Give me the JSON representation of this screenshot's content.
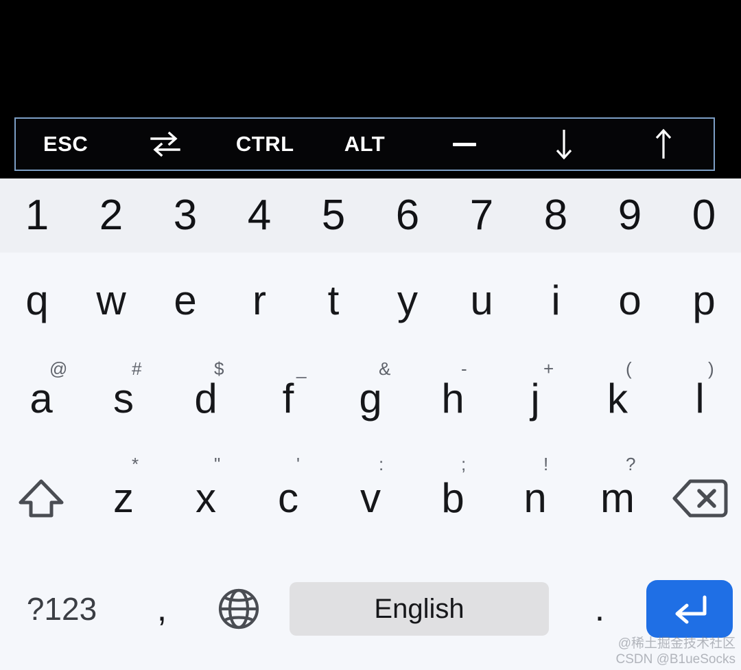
{
  "colors": {
    "toolbar_bg": "#050507",
    "toolbar_border": "#7d9fc6",
    "toolbar_text": "#ffffff",
    "number_row_bg": "#eef0f4",
    "keyboard_bg": "#f5f7fb",
    "key_text": "#16171a",
    "hint_text": "#5f636b",
    "spacebar_bg": "#e0e0e2",
    "enter_key_bg": "#1f6fe5",
    "screen_bg": "#000000"
  },
  "toolbar": {
    "keys": [
      {
        "label": "ESC",
        "name": "esc-key",
        "type": "text"
      },
      {
        "label": "",
        "name": "tab-key",
        "type": "icon",
        "icon": "tab-swap-icon"
      },
      {
        "label": "CTRL",
        "name": "ctrl-key",
        "type": "text"
      },
      {
        "label": "ALT",
        "name": "alt-key",
        "type": "text"
      },
      {
        "label": "–",
        "name": "minus-key",
        "type": "dash",
        "icon": "dash-icon"
      },
      {
        "label": "↓",
        "name": "arrow-down-key",
        "type": "icon",
        "icon": "arrow-down-icon"
      },
      {
        "label": "↑",
        "name": "arrow-up-key",
        "type": "icon",
        "icon": "arrow-up-icon"
      }
    ]
  },
  "keyboard": {
    "language": "English",
    "rows": {
      "numbers": [
        {
          "main": "1",
          "hint": ""
        },
        {
          "main": "2",
          "hint": ""
        },
        {
          "main": "3",
          "hint": ""
        },
        {
          "main": "4",
          "hint": ""
        },
        {
          "main": "5",
          "hint": ""
        },
        {
          "main": "6",
          "hint": ""
        },
        {
          "main": "7",
          "hint": ""
        },
        {
          "main": "8",
          "hint": ""
        },
        {
          "main": "9",
          "hint": ""
        },
        {
          "main": "0",
          "hint": ""
        }
      ],
      "top": [
        {
          "main": "q",
          "hint": ""
        },
        {
          "main": "w",
          "hint": ""
        },
        {
          "main": "e",
          "hint": ""
        },
        {
          "main": "r",
          "hint": ""
        },
        {
          "main": "t",
          "hint": ""
        },
        {
          "main": "y",
          "hint": ""
        },
        {
          "main": "u",
          "hint": ""
        },
        {
          "main": "i",
          "hint": ""
        },
        {
          "main": "o",
          "hint": ""
        },
        {
          "main": "p",
          "hint": ""
        }
      ],
      "home": [
        {
          "main": "a",
          "hint": "@"
        },
        {
          "main": "s",
          "hint": "#"
        },
        {
          "main": "d",
          "hint": "$"
        },
        {
          "main": "f",
          "hint": "_"
        },
        {
          "main": "g",
          "hint": "&"
        },
        {
          "main": "h",
          "hint": "-"
        },
        {
          "main": "j",
          "hint": "+"
        },
        {
          "main": "k",
          "hint": "("
        },
        {
          "main": "l",
          "hint": ")"
        }
      ],
      "bottom_letters": [
        {
          "main": "z",
          "hint": "*"
        },
        {
          "main": "x",
          "hint": "\""
        },
        {
          "main": "c",
          "hint": "'"
        },
        {
          "main": "v",
          "hint": ":"
        },
        {
          "main": "b",
          "hint": ";"
        },
        {
          "main": "n",
          "hint": "!"
        },
        {
          "main": "m",
          "hint": "?"
        }
      ]
    },
    "shift_key": {
      "name": "shift-key",
      "icon": "shift-arrow-up-icon"
    },
    "backspace_key": {
      "name": "backspace-key",
      "icon": "backspace-icon"
    },
    "symbols_key": {
      "label": "?123",
      "name": "symbols-toggle-key"
    },
    "comma_key": {
      "label": ",",
      "name": "comma-key"
    },
    "globe_key": {
      "name": "language-switch-key",
      "icon": "globe-icon"
    },
    "space_key": {
      "label": "English",
      "name": "space-key"
    },
    "period_key": {
      "label": ".",
      "name": "period-key"
    },
    "enter_key": {
      "name": "enter-key",
      "icon": "enter-return-icon"
    }
  },
  "watermark": {
    "line1": "@稀土掘金技术社区",
    "line2": "CSDN @B1ueSocks"
  }
}
